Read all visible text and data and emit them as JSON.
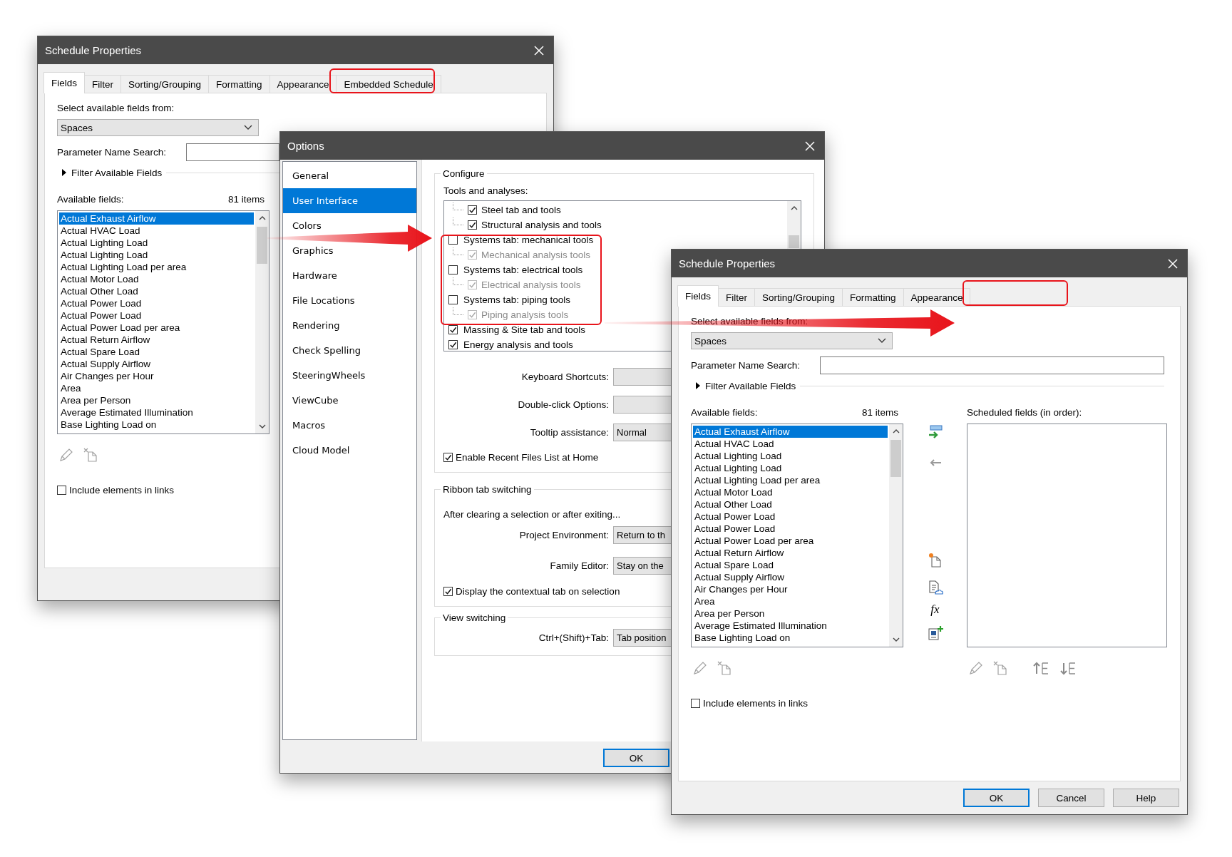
{
  "back_window": {
    "title": "Schedule Properties",
    "tabs": [
      {
        "label": "Fields",
        "selected": true
      },
      {
        "label": "Filter",
        "selected": false
      },
      {
        "label": "Sorting/Grouping",
        "selected": false
      },
      {
        "label": "Formatting",
        "selected": false
      },
      {
        "label": "Appearance",
        "selected": false
      },
      {
        "label": "Embedded Schedule",
        "selected": false
      }
    ],
    "source_label": "Select available fields from:",
    "source": "Spaces",
    "search_label": "Parameter Name Search:",
    "filter_label": "Filter Available Fields",
    "filter_expanded": false,
    "available_label": "Available fields:",
    "count": "81 items",
    "fields": [
      {
        "label": "Actual Exhaust Airflow",
        "selected": true
      },
      {
        "label": "Actual HVAC Load",
        "selected": false
      },
      {
        "label": "Actual Lighting Load",
        "selected": false
      },
      {
        "label": "Actual Lighting Load",
        "selected": false
      },
      {
        "label": "Actual Lighting Load per area",
        "selected": false
      },
      {
        "label": "Actual Motor Load",
        "selected": false
      },
      {
        "label": "Actual Other Load",
        "selected": false
      },
      {
        "label": "Actual Power Load",
        "selected": false
      },
      {
        "label": "Actual Power Load",
        "selected": false
      },
      {
        "label": "Actual Power Load per area",
        "selected": false
      },
      {
        "label": "Actual Return Airflow",
        "selected": false
      },
      {
        "label": "Actual Spare Load",
        "selected": false
      },
      {
        "label": "Actual Supply Airflow",
        "selected": false
      },
      {
        "label": "Air Changes per Hour",
        "selected": false
      },
      {
        "label": "Area",
        "selected": false
      },
      {
        "label": "Area per Person",
        "selected": false
      },
      {
        "label": "Average Estimated Illumination",
        "selected": false
      },
      {
        "label": "Base Lighting Load on",
        "selected": false
      }
    ],
    "include_links": {
      "label": "Include elements in links",
      "checked": false
    }
  },
  "options": {
    "title": "Options",
    "nav": [
      {
        "label": "General",
        "selected": false
      },
      {
        "label": "User Interface",
        "selected": true
      },
      {
        "label": "Colors",
        "selected": false
      },
      {
        "label": "Graphics",
        "selected": false
      },
      {
        "label": "Hardware",
        "selected": false
      },
      {
        "label": "File Locations",
        "selected": false
      },
      {
        "label": "Rendering",
        "selected": false
      },
      {
        "label": "Check Spelling",
        "selected": false
      },
      {
        "label": "SteeringWheels",
        "selected": false
      },
      {
        "label": "ViewCube",
        "selected": false
      },
      {
        "label": "Macros",
        "selected": false
      },
      {
        "label": "Cloud Model",
        "selected": false
      }
    ],
    "configure": {
      "title": "Configure",
      "tools_label": "Tools and analyses:",
      "tools": [
        {
          "children": [
            {
              "label": "Steel tab and tools",
              "checked": true,
              "disabled": false
            },
            {
              "label": "Structural analysis and tools",
              "checked": true,
              "disabled": false
            }
          ]
        },
        {
          "label": "Systems tab: mechanical tools",
          "checked": false,
          "disabled": false,
          "children": [
            {
              "label": "Mechanical analysis tools",
              "checked": true,
              "disabled": true
            }
          ]
        },
        {
          "label": "Systems tab: electrical tools",
          "checked": false,
          "disabled": false,
          "children": [
            {
              "label": "Electrical analysis tools",
              "checked": true,
              "disabled": true
            }
          ]
        },
        {
          "label": "Systems tab: piping tools",
          "checked": false,
          "disabled": false,
          "children": [
            {
              "label": "Piping analysis tools",
              "checked": true,
              "disabled": true
            }
          ]
        },
        {
          "label": "Massing & Site tab and tools",
          "checked": true,
          "disabled": false
        },
        {
          "label": "Energy analysis and tools",
          "checked": true,
          "disabled": false
        }
      ],
      "settings": [
        {
          "label": "Keyboard Shortcuts:"
        },
        {
          "label": "Double-click Options:"
        },
        {
          "label": "Tooltip assistance:",
          "value": "Normal"
        }
      ],
      "recent_files": {
        "label": "Enable Recent Files List at Home",
        "checked": true
      }
    },
    "ribbon": {
      "title": "Ribbon tab switching",
      "note": "After clearing a selection or after exiting...",
      "settings": [
        {
          "label": "Project Environment:",
          "value": "Return to th"
        },
        {
          "label": "Family Editor:",
          "value": "Stay on the"
        }
      ],
      "contextual": {
        "label": "Display the contextual tab on selection",
        "checked": true
      }
    },
    "view_switching": {
      "title": "View switching",
      "settings": [
        {
          "label": "Ctrl+(Shift)+Tab:",
          "value": "Tab position"
        }
      ]
    },
    "buttons": [
      {
        "label": "OK",
        "default": true
      }
    ]
  },
  "front_window": {
    "title": "Schedule Properties",
    "tabs": [
      {
        "label": "Fields",
        "selected": true
      },
      {
        "label": "Filter",
        "selected": false
      },
      {
        "label": "Sorting/Grouping",
        "selected": false
      },
      {
        "label": "Formatting",
        "selected": false
      },
      {
        "label": "Appearance",
        "selected": false
      }
    ],
    "source_label": "Select available fields from:",
    "source": "Spaces",
    "search_label": "Parameter Name Search:",
    "filter_label": "Filter Available Fields",
    "filter_expanded": false,
    "available_label": "Available fields:",
    "count": "81 items",
    "fields": [
      {
        "label": "Actual Exhaust Airflow",
        "selected": true
      },
      {
        "label": "Actual HVAC Load",
        "selected": false
      },
      {
        "label": "Actual Lighting Load",
        "selected": false
      },
      {
        "label": "Actual Lighting Load",
        "selected": false
      },
      {
        "label": "Actual Lighting Load per area",
        "selected": false
      },
      {
        "label": "Actual Motor Load",
        "selected": false
      },
      {
        "label": "Actual Other Load",
        "selected": false
      },
      {
        "label": "Actual Power Load",
        "selected": false
      },
      {
        "label": "Actual Power Load",
        "selected": false
      },
      {
        "label": "Actual Power Load per area",
        "selected": false
      },
      {
        "label": "Actual Return Airflow",
        "selected": false
      },
      {
        "label": "Actual Spare Load",
        "selected": false
      },
      {
        "label": "Actual Supply Airflow",
        "selected": false
      },
      {
        "label": "Air Changes per Hour",
        "selected": false
      },
      {
        "label": "Area",
        "selected": false
      },
      {
        "label": "Area per Person",
        "selected": false
      },
      {
        "label": "Average Estimated Illumination",
        "selected": false
      },
      {
        "label": "Base Lighting Load on",
        "selected": false
      }
    ],
    "scheduled_label": "Scheduled fields (in order):",
    "formula_button": "fx",
    "include_links": {
      "label": "Include elements in links",
      "checked": false
    },
    "buttons": [
      {
        "label": "OK",
        "default": true
      },
      {
        "label": "Cancel",
        "default": false
      },
      {
        "label": "Help",
        "default": false
      }
    ]
  },
  "annotations": [
    {
      "kind": "frame"
    },
    {
      "kind": "arrow"
    },
    {
      "kind": "frame"
    },
    {
      "kind": "arrow"
    },
    {
      "kind": "frame"
    }
  ]
}
